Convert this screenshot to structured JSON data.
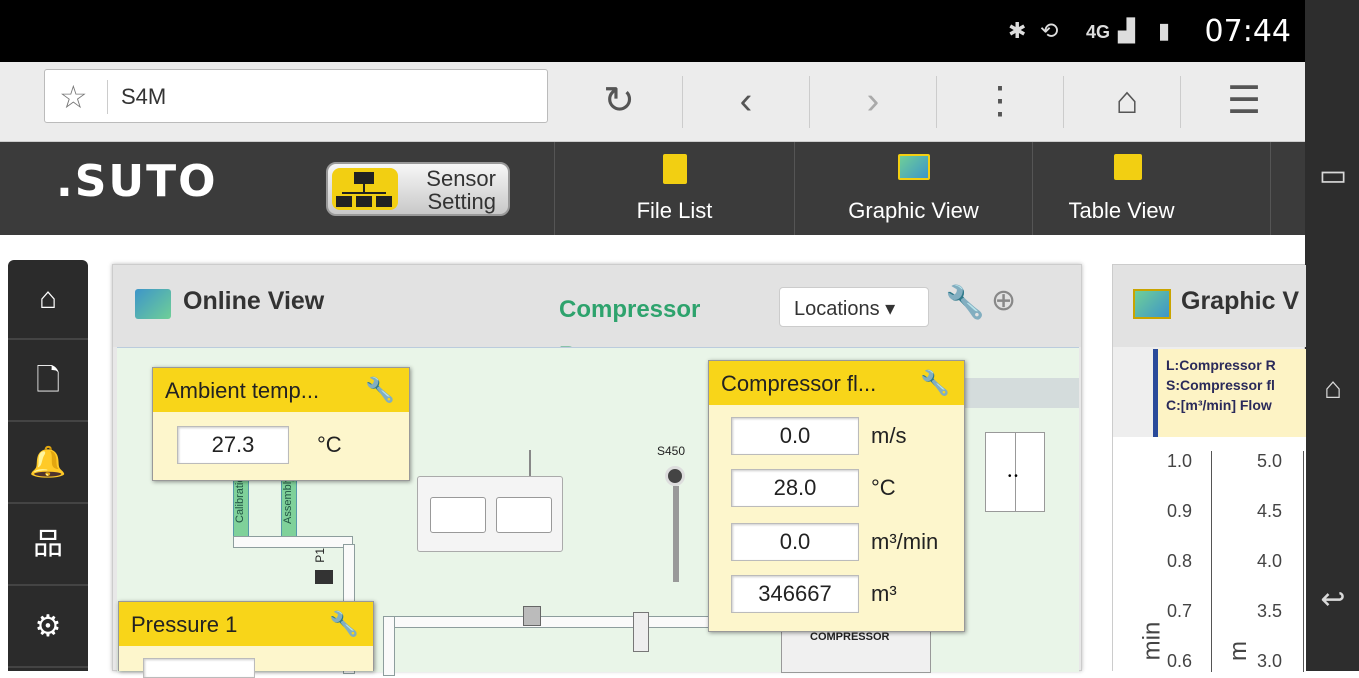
{
  "status_bar": {
    "time": "07:44",
    "network": "4G",
    "icons": [
      "bluetooth-icon",
      "screen-rotation-icon",
      "signal-icon",
      "battery-icon"
    ]
  },
  "browser": {
    "url": "S4M",
    "buttons": [
      "reload",
      "back",
      "forward",
      "menu",
      "home",
      "bookmarks"
    ]
  },
  "app_toolbar": {
    "logo": ".SUTO",
    "sensor_setting": {
      "line1": "Sensor",
      "line2": "Setting"
    },
    "file_list": "File List",
    "graphic_view": "Graphic View",
    "table_view": "Table View"
  },
  "sidebar": {
    "items": [
      "home",
      "document",
      "alarm",
      "network",
      "settings"
    ]
  },
  "online_view": {
    "title": "Online View",
    "location_name": "Compressor Room",
    "locations_label": "Locations ▾",
    "diagram_labels": {
      "calibration": "Calibratio",
      "assembly": "Assembly",
      "s450": "S450",
      "p1": "P1",
      "compressor": "COMPRESSOR"
    },
    "sensors": [
      {
        "name": "Ambient temp...",
        "readings": [
          {
            "value": "27.3",
            "unit": "°C"
          }
        ]
      },
      {
        "name": "Compressor fl...",
        "readings": [
          {
            "value": "0.0",
            "unit": "m/s"
          },
          {
            "value": "28.0",
            "unit": "°C"
          },
          {
            "value": "0.0",
            "unit": "m³/min"
          },
          {
            "value": "346667",
            "unit": "m³"
          }
        ]
      },
      {
        "name": "Pressure 1",
        "readings": []
      }
    ]
  },
  "graphic_view": {
    "title": "Graphic V",
    "legend": [
      "L:Compressor R",
      "S:Compressor fl",
      "C:[m³/min] Flow"
    ],
    "left_axis_ticks": [
      "1.0",
      "0.9",
      "0.8",
      "0.7",
      "0.6"
    ],
    "right_axis_ticks": [
      "5.0",
      "4.5",
      "4.0",
      "3.5",
      "3.0"
    ],
    "left_axis_label": "min",
    "right_axis_label": "m"
  }
}
